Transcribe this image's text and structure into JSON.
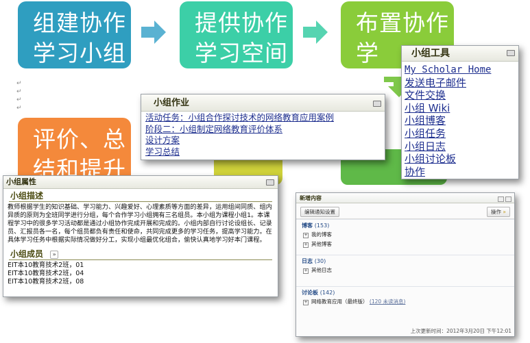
{
  "steps": [
    {
      "line1": "组建协作",
      "line2": "学习小组",
      "color": "#2f9ec0"
    },
    {
      "line1": "提供协作",
      "line2": "学习空间",
      "color": "#3ccfa7"
    },
    {
      "line1": "布置协作",
      "line2": "学",
      "color": "#8acc3a"
    },
    {
      "line1": "评价、总",
      "line2": "结和提升",
      "color": "#f4893b"
    }
  ],
  "pilcrow": "↵",
  "tools_panel": {
    "title": "小组工具",
    "links": [
      "My Scholar Home",
      "发送电子邮件",
      "文件交换",
      "小组 Wiki",
      "小组博客",
      "小组任务",
      "小组日志",
      "小组讨论板",
      "协作"
    ]
  },
  "homework_panel": {
    "title": "小组作业",
    "links": [
      "活动任务：小组合作探讨技术的网络教育应用案例",
      "阶段二：小组制定网络教育评价体系",
      "设计方案",
      "学习总结"
    ]
  },
  "attributes_panel": {
    "title": "小组属性",
    "description_heading": "小组描述",
    "description": "教师根据学生的知识基础、学习能力、兴趣爱好、心理素质等方面的差异，运用组间同质、组内异质的原则为全班同学进行分组，每个合作学习小组拥有三名组员。本小组为课程小组1。本课程学习中的很多学习活动都是通过小组协作完成开展和完成的。小组内部自行讨论设组长、记录员、汇报员各一名，每个组员都负有责任和使命，共同完成更多的学习任务，提高学习能力。在具体学习任务中根据实际情况做好分工，实现小组最优化组合，偷快认真地学习好本门课程。",
    "members_heading": "小组成员",
    "members": [
      "EIT本10教育技术2班，01",
      "EIT本10教育技术2班，04",
      "EIT本10教育技术2班，08"
    ]
  },
  "news_panel": {
    "title": "新增内容",
    "edit_button": "编辑通知设置",
    "action_button": "操作",
    "sections": [
      {
        "name": "博客",
        "count": "(153)",
        "items": [
          "我的博客",
          "其他博客"
        ]
      },
      {
        "name": "日志",
        "count": "(30)",
        "items": [
          "其他日志"
        ]
      },
      {
        "name": "讨论板",
        "count": "(142)",
        "items": [
          "网络教育应用（最终版）"
        ],
        "unread": "(120 未读消息)"
      }
    ],
    "footer": "上次更新时间：2012年3月20日 下午12:01"
  }
}
